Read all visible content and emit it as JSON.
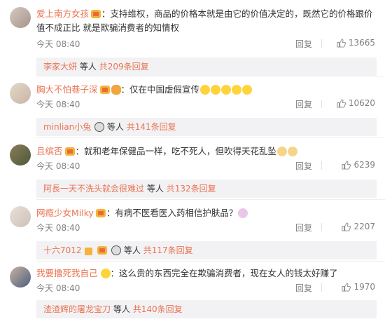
{
  "reply_label": "回复",
  "others_label": "等人",
  "comments": [
    {
      "username": "爱上南方女孩",
      "text": "：支持维权，商品的价格本就是由它的价值决定的，既然它的价格跟价值不成正比 就是欺骗消费者的知情权",
      "time": "今天 08:40",
      "likes": "13665",
      "sub_names": "李家大妍",
      "sub_total": "共209条回复"
    },
    {
      "username": "胸大不怕巷子深",
      "text": "：仅在中国虚假宣传",
      "time": "今天 08:40",
      "likes": "10620",
      "sub_names": "minlian小兔",
      "sub_total": "共141条回复"
    },
    {
      "username": "且缤否",
      "text": "：就和老年保健品一样，吃不死人，但吹得天花乱坠",
      "time": "今天 08:40",
      "likes": "6239",
      "sub_names": "阿長一天不洗头就会很难过",
      "sub_total": "共132条回复"
    },
    {
      "username": "网瘾少女Milky",
      "text": "：有病不医看医入药相信护肤品？",
      "time": "今天 08:40",
      "likes": "2207",
      "sub_names": "十六7012",
      "sub_total": "共117条回复"
    },
    {
      "username": "我要撸死我自己",
      "text": "：这么贵的东西完全在欺骗消费者，现在女人的钱太好赚了",
      "time": "今天 08:40",
      "likes": "1970",
      "sub_names": "渣渣辉的屠龙宝刀",
      "sub_total": "共140条回复"
    }
  ]
}
